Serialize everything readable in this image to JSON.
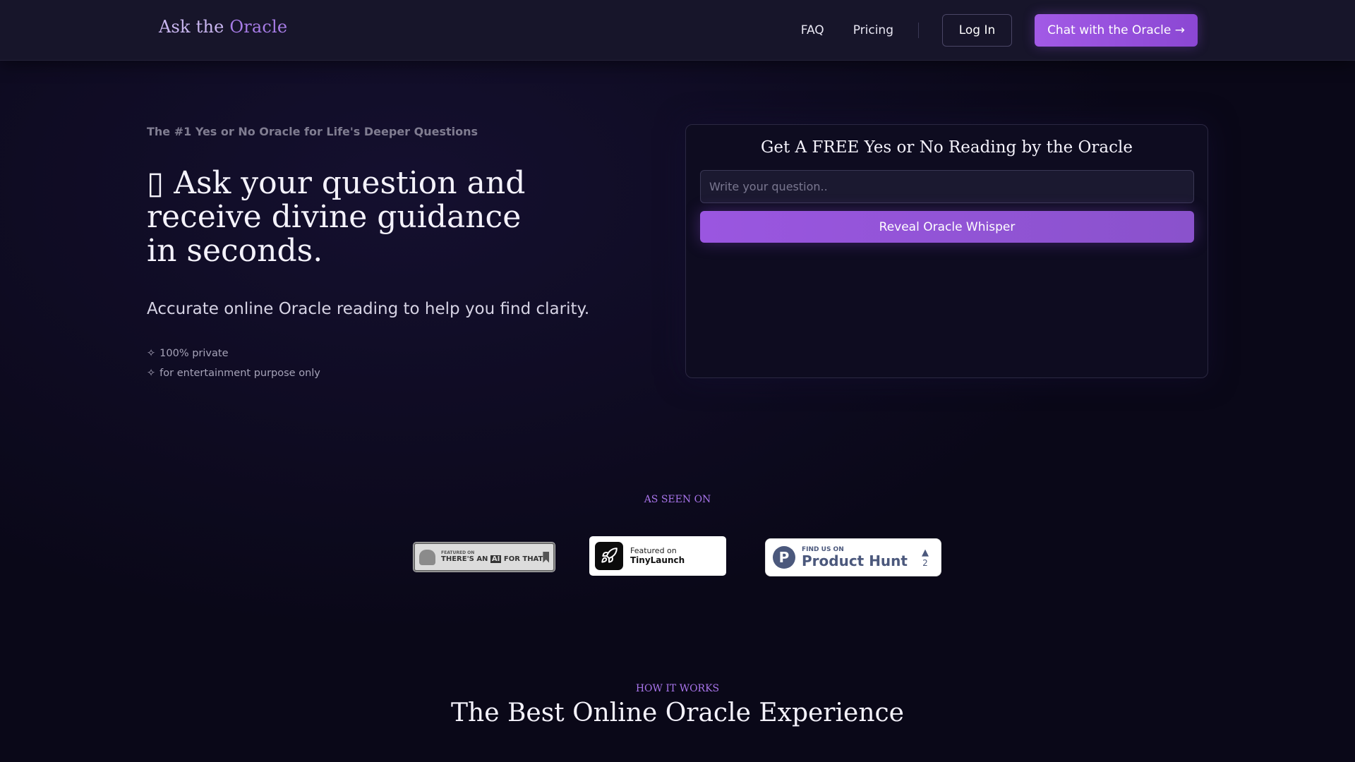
{
  "brand": {
    "name_part1": "Ask the ",
    "name_part2": "Oracle"
  },
  "nav": {
    "faq": "FAQ",
    "pricing": "Pricing",
    "login": "Log In",
    "cta": "Chat with the Oracle →"
  },
  "hero": {
    "eyebrow": "The #1 Yes or No Oracle for Life's Deeper Questions",
    "title_icon": "▯",
    "title_line1": "Ask your question and",
    "title_line2": "receive divine guidance",
    "title_line3": "in seconds.",
    "subtitle": "Accurate online Oracle reading to help you find clarity.",
    "bullet_icon": "✧",
    "bullets": [
      "100% private",
      "for entertainment purpose only"
    ]
  },
  "reading_card": {
    "title": "Get A FREE Yes or No Reading by the Oracle",
    "input_placeholder": "Write your question..",
    "input_value": "",
    "button": "Reveal Oracle Whisper"
  },
  "as_seen_on": {
    "label": "AS SEEN ON",
    "badges": {
      "aift": {
        "small": "FEATURED ON",
        "big_pre": "THERE'S AN ",
        "big_ai": "AI",
        "big_post": " FOR THAT"
      },
      "tinylaunch": {
        "featured": "Featured on",
        "name": "TinyLaunch"
      },
      "producthunt": {
        "logo": "P",
        "find": "FIND US ON",
        "name": "Product Hunt",
        "arrow": "▲",
        "count": "2"
      }
    }
  },
  "how_it_works": {
    "label": "HOW IT WORKS",
    "title": "The Best Online Oracle Experience"
  },
  "colors": {
    "background": "#0a0818",
    "navbar": "#17152a",
    "accent": "#a874ea",
    "button_gradient_start": "#a25ae6",
    "button_gradient_end": "#8b47d3"
  },
  "icons": [
    "sparkle-icon",
    "rocket-icon",
    "product-hunt-logo-icon",
    "upvote-arrow-icon",
    "bookmark-icon"
  ]
}
